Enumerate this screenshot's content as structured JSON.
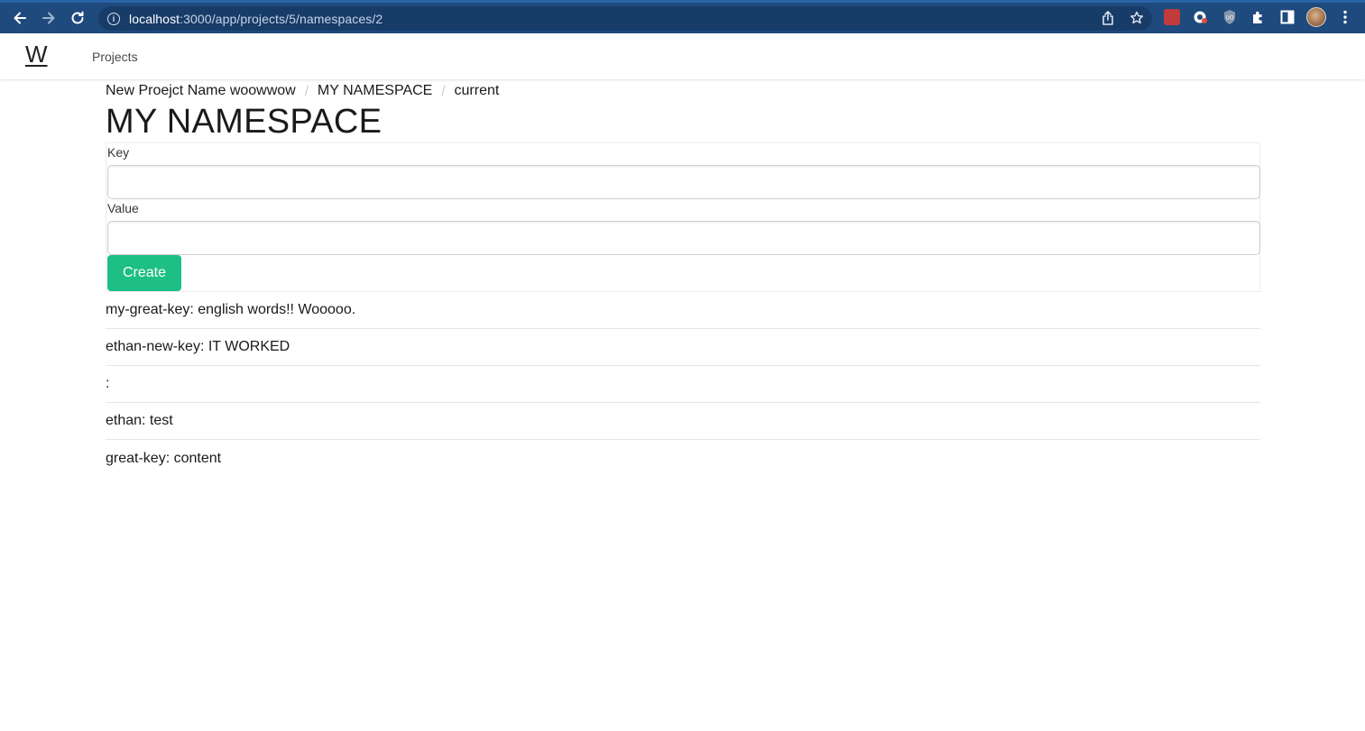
{
  "browser": {
    "url_host": "localhost",
    "url_path": ":3000/app/projects/5/namespaces/2"
  },
  "app_nav": {
    "brand": "W",
    "links": [
      {
        "label": "Projects"
      }
    ]
  },
  "breadcrumb": {
    "items": [
      {
        "label": "New Proejct Name woowwow"
      },
      {
        "label": "MY NAMESPACE"
      },
      {
        "label": "current"
      }
    ],
    "separator": "/"
  },
  "page": {
    "title": "MY NAMESPACE"
  },
  "form": {
    "key_label": "Key",
    "key_value": "",
    "value_label": "Value",
    "value_value": "",
    "create_label": "Create"
  },
  "entries": [
    {
      "text": "my-great-key: english words!! Wooooo."
    },
    {
      "text": "ethan-new-key: IT WORKED"
    },
    {
      "text": ":"
    },
    {
      "text": "ethan: test"
    },
    {
      "text": "great-key: content"
    }
  ],
  "colors": {
    "browser_bar": "#1e4a7e",
    "accent_button": "#1dbf84"
  }
}
